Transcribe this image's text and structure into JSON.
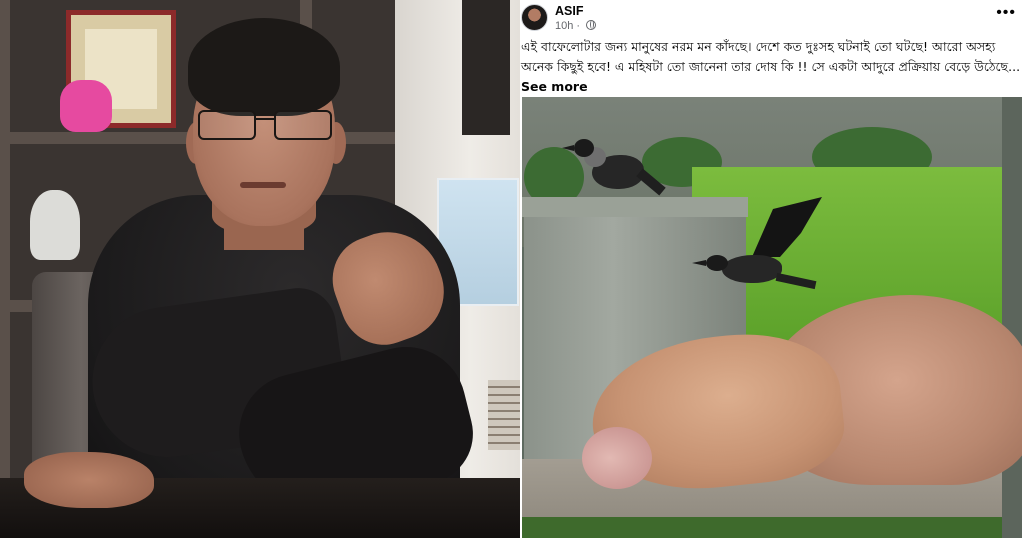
{
  "post": {
    "author": "ASIF",
    "time": "10h",
    "dot": "·",
    "more": "•••",
    "text": "এই বাফেলোটার জন্য মানুষের নরম মন কাঁদছে। দেশে কত দুঃসহ ঘটনাই তো ঘটছে! আরো অসহ্য অনেক কিছুই হবে! এ মহিষটা তো জানেনা তার দোষ কি !! সে একটা আদুরে প্রক্রিয়ায় বেড়ে উঠেছে...",
    "see_more": "See more"
  },
  "colors": {
    "text": "#050505",
    "meta": "#65676b",
    "shirt": "#1b1a1b",
    "grass": "#6fb236"
  },
  "icons": {
    "privacy": "globe-icon",
    "options": "more-options-icon"
  }
}
